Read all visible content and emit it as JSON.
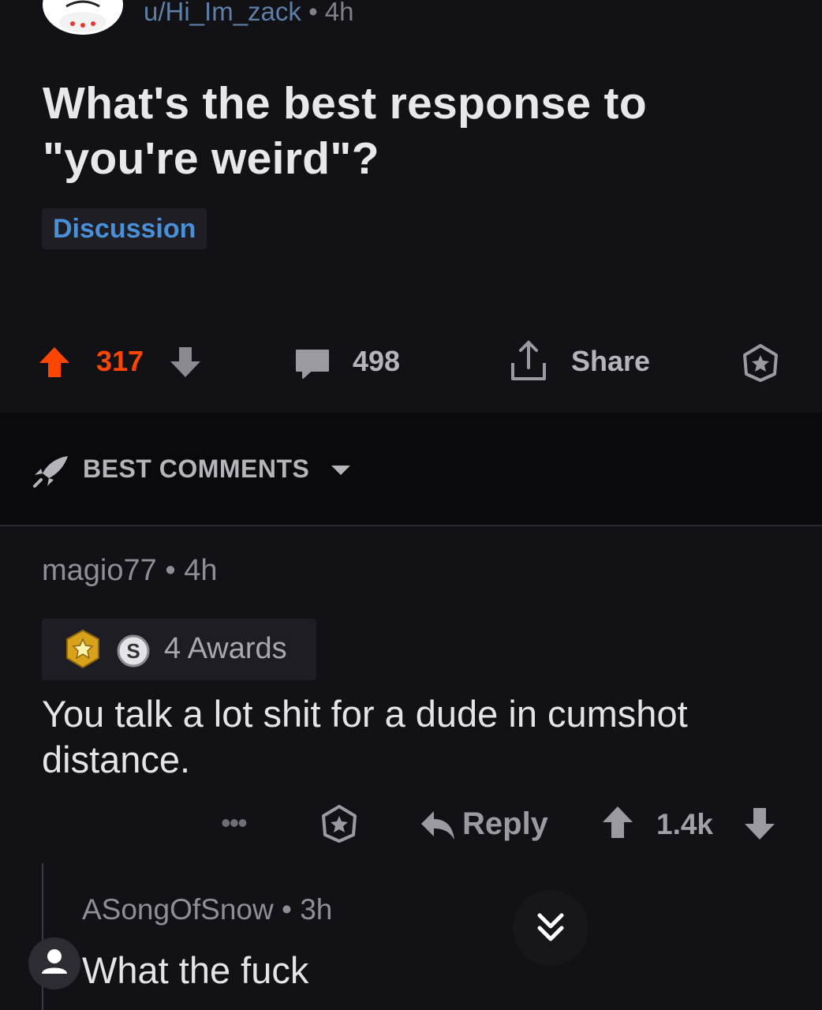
{
  "post": {
    "author": "u/Hi_Im_zack",
    "separator": " • ",
    "age": "4h",
    "title": "What's the best response to \"you're weird\"?",
    "flair": "Discussion",
    "score": "317",
    "comment_count": "498",
    "share_label": "Share"
  },
  "sort": {
    "label": "BEST COMMENTS"
  },
  "comment": {
    "author": "magio77",
    "separator": " • ",
    "age": "4h",
    "awards_label": "4 Awards",
    "body": "You talk a lot shit for a dude in cumshot distance.",
    "more_label": "•••",
    "reply_label": "Reply",
    "score": "1.4k"
  },
  "child_comment": {
    "author": "ASongOfSnow",
    "separator": " • ",
    "age": "3h",
    "body": "What the fuck"
  },
  "colors": {
    "background": "#121216",
    "upvote_active": "#ff4500",
    "flair_text": "#4a90d9",
    "sort_bar": "#0a0a0c"
  }
}
